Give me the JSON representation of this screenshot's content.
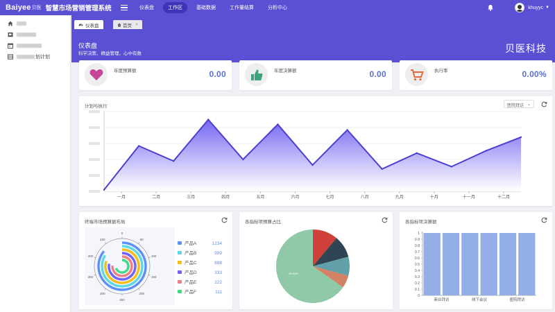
{
  "app": {
    "brand": "Baiyee",
    "brand_cn": "贝医",
    "system_name": "智慧市场营销管理系统",
    "username": "khuyyc",
    "accent": "#5b4fd4",
    "value_color": "#5a6fd1"
  },
  "topnav": [
    {
      "label": "仪表盘",
      "active": false
    },
    {
      "label": "工作区",
      "active": true
    },
    {
      "label": "基础数据",
      "active": false
    },
    {
      "label": "工作量结算",
      "active": false
    },
    {
      "label": "分析中心",
      "active": false
    }
  ],
  "sidebar": {
    "items": [
      {
        "icon": "home-icon"
      },
      {
        "icon": "folder-icon"
      },
      {
        "icon": "calendar-icon"
      },
      {
        "icon": "table-icon",
        "label_suffix": "划计划"
      }
    ]
  },
  "tabs": [
    {
      "label": "仪表盘",
      "icon": "dashboard-icon",
      "active": true
    },
    {
      "label": "首页",
      "icon": "home-icon",
      "active": false,
      "close": "×"
    }
  ],
  "header": {
    "title": "仪表盘",
    "subtitle": "科学决策、精益管理、心中有数",
    "company": "贝医科技"
  },
  "stats": [
    {
      "label": "年度预算额",
      "value": "0.00",
      "icon": "heart-icon",
      "icon_color": "#c6479a"
    },
    {
      "label": "年度决算额",
      "value": "0.00",
      "icon": "thumbs-up-icon",
      "icon_color": "#3aa57a"
    },
    {
      "label": "执行率",
      "value": "0.00%",
      "icon": "cart-icon",
      "icon_color": "#e56a3c"
    }
  ],
  "plan_chart": {
    "title": "计划与执行",
    "select_value": "医院拜访",
    "chart_data": {
      "type": "area",
      "categories": [
        "一月",
        "二月",
        "三月",
        "四月",
        "五月",
        "六月",
        "七月",
        "八月",
        "九月",
        "十月",
        "十一月",
        "十二月"
      ],
      "series": [
        {
          "values": [
            2,
            57,
            38,
            90,
            40,
            84,
            33,
            77,
            28,
            48,
            31,
            51,
            68
          ]
        }
      ],
      "grid": true,
      "color": "#4a3fd0"
    }
  },
  "radial_chart": {
    "title": "终端市场预算额布局",
    "chart_data": {
      "type": "bar",
      "polar": true,
      "angle_ticks": [
        "0",
        "50",
        "100",
        "150",
        "200",
        "250",
        "300",
        "350",
        "400",
        "450"
      ],
      "series": [
        {
          "name": "产品A",
          "value": "1234",
          "color": "#5b8ff9"
        },
        {
          "name": "产品B",
          "value": "999",
          "color": "#5ad8e6"
        },
        {
          "name": "产品C",
          "value": "888",
          "color": "#f6bd16"
        },
        {
          "name": "产品D",
          "value": "333",
          "color": "#7262fd"
        },
        {
          "name": "产品E",
          "value": "222",
          "color": "#f08080"
        },
        {
          "name": "产品F",
          "value": "111",
          "color": "#3ddc84"
        }
      ]
    }
  },
  "pie_chart": {
    "title": "各指标项预算占比",
    "chart_data": {
      "type": "pie",
      "slices": [
        {
          "label": "99.93%",
          "value": 99.93,
          "color": "#8fc9a8"
        },
        {
          "label": "",
          "value": 0.03,
          "color": "#d0403a"
        },
        {
          "label": "",
          "value": 0.02,
          "color": "#2f4554"
        },
        {
          "label": "",
          "value": 0.01,
          "color": "#61a0a8"
        },
        {
          "label": "",
          "value": 0.01,
          "color": "#d48265"
        }
      ]
    }
  },
  "bar_chart": {
    "title": "各指标项决算额",
    "chart_data": {
      "type": "bar",
      "categories": [
        "商业拜访",
        "",
        "线下会议",
        "",
        "医院拜访",
        ""
      ],
      "values": [
        1,
        1,
        1,
        1,
        1,
        1
      ],
      "yticks": [
        "0",
        "0.1",
        "0.2",
        "0.3",
        "0.4",
        "0.5",
        "0.6",
        "0.7",
        "0.8",
        "0.9",
        "1"
      ],
      "ylim": [
        0,
        1
      ],
      "color": "#94aee8"
    }
  }
}
